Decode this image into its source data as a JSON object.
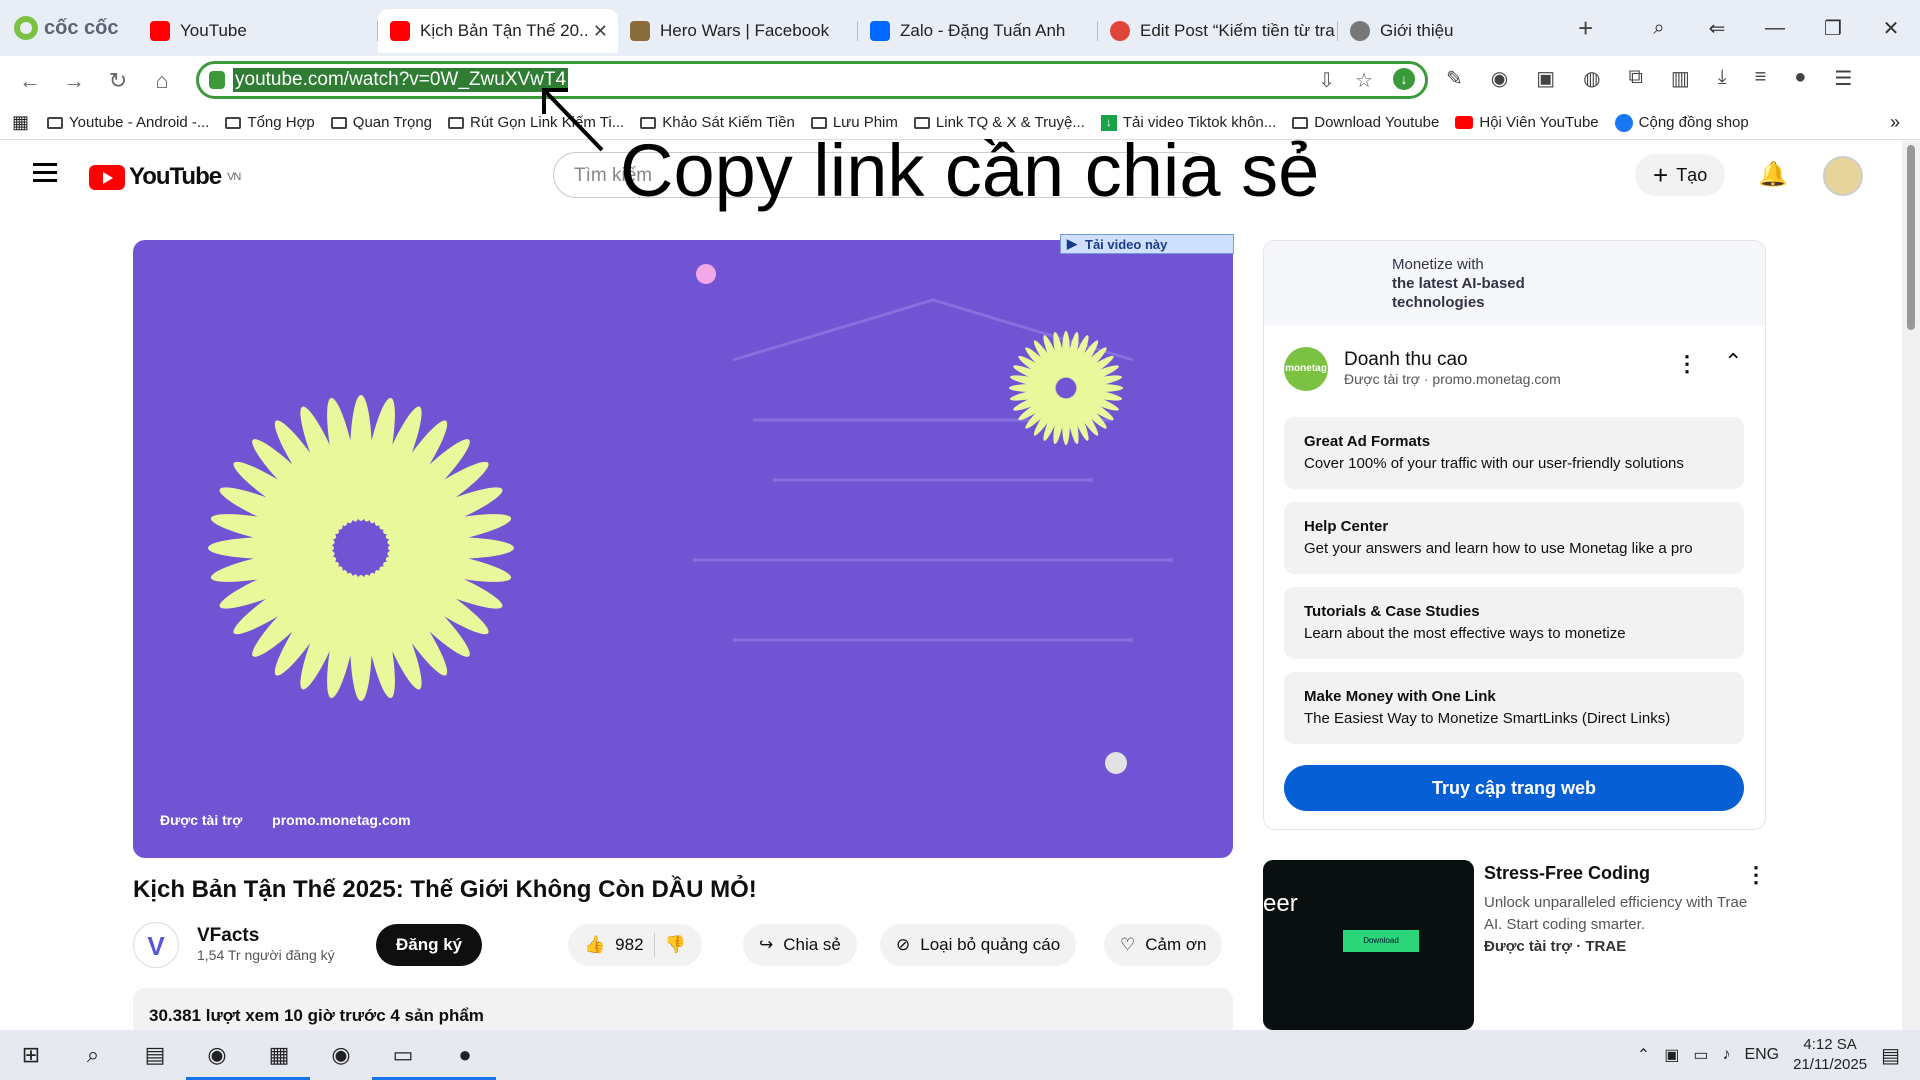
{
  "browser": {
    "brand": "cốc cốc",
    "tabs": [
      {
        "label": "YouTube",
        "active": false
      },
      {
        "label": "Kịch Bản Tận Thế 20..",
        "active": true
      },
      {
        "label": "Hero Wars | Facebook",
        "active": false
      },
      {
        "label": "Zalo - Đặng Tuấn Anh",
        "active": false
      },
      {
        "label": "Edit Post “Kiếm tiền từ tra",
        "active": false
      },
      {
        "label": "Giới thiệu",
        "active": false
      }
    ],
    "url": "youtube.com/watch?v=0W_ZwuXVwT4",
    "bookmarks": [
      "Youtube - Android -...",
      "Tổng Hợp",
      "Quan Trọng",
      "Rút Gọn Link Kiếm Ti...",
      "Khảo Sát Kiếm Tiền",
      "Lưu Phim",
      "Link TQ & X & Truyệ...",
      "Tải video Tiktok khôn...",
      "Download Youtube",
      "Hội Viên YouTube",
      "Cộng đồng shop"
    ]
  },
  "overlay": {
    "caption": "Copy link cần chia sẻ"
  },
  "youtube": {
    "logo_region": "VN",
    "search_placeholder": "Tìm kiếm",
    "create_label": "Tạo",
    "download_button": "Tải video này",
    "player_sponsor": "Được tài trợ",
    "player_domain": "promo.monetag.com",
    "video_title": "Kịch Bản Tận Thế 2025: Thế Giới Không Còn DẦU MỎ!",
    "channel_name": "VFacts",
    "channel_subs": "1,54 Tr người đăng ký",
    "subscribe_label": "Đăng ký",
    "like_count": "982",
    "share_label": "Chia sẻ",
    "remove_ads_label": "Loại bỏ quảng cáo",
    "thanks_label": "Cảm ơn",
    "meta_text": "30.381 lượt xem  10 giờ trước  4 sản phẩm"
  },
  "ad": {
    "banner_lines": [
      "Monetize with",
      "the latest AI-based",
      "technologies"
    ],
    "avatar_text": "monetag",
    "advertiser": "Doanh thu cao",
    "sponsor_line": "Được tài trợ · promo.monetag.com",
    "cards": [
      {
        "title": "Great Ad Formats",
        "desc": "Cover 100% of your traffic with our user-friendly solutions"
      },
      {
        "title": "Help Center",
        "desc": "Get your answers and learn how to use Monetag like a pro"
      },
      {
        "title": "Tutorials & Case Studies",
        "desc": "Learn about the most effective ways to monetize"
      },
      {
        "title": "Make Money with One Link",
        "desc": "The Easiest Way to Monetize SmartLinks (Direct Links)"
      }
    ],
    "cta": "Truy cập trang web"
  },
  "suggestion": {
    "thumb_text": "eer",
    "title": "Stress-Free Coding",
    "desc": "Unlock unparalleled efficiency with Trae AI. Start coding smarter.",
    "sponsor": "Được tài trợ · TRAE"
  },
  "taskbar": {
    "lang": "ENG",
    "time": "4:12 SA",
    "date": "21/11/2025"
  },
  "colors": {
    "youtube_red": "#ff0000",
    "cta_blue": "#065fd4",
    "player_bg": "#7054d3",
    "url_highlight": "#2e7d32"
  }
}
